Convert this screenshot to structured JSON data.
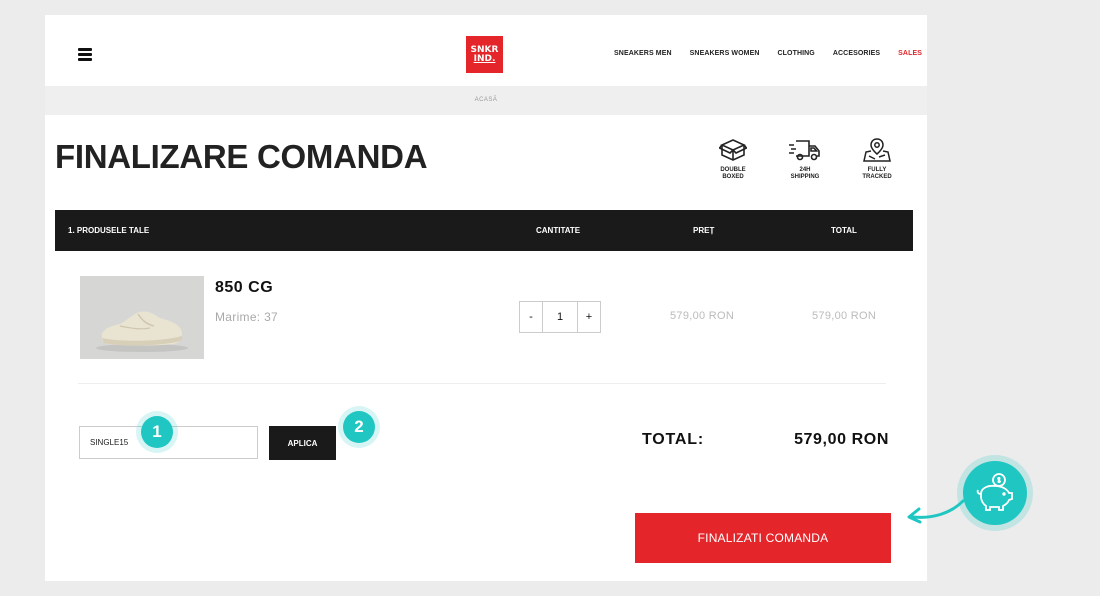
{
  "header": {
    "logo_line1": "SNKR",
    "logo_line2": "IND.",
    "nav": [
      "SNEAKERS MEN",
      "SNEAKERS WOMEN",
      "CLOTHING",
      "ACCESORIES",
      "SALES"
    ]
  },
  "breadcrumb": "ACASĂ",
  "page_title": "FINALIZARE COMANDA",
  "features": [
    {
      "icon": "box-icon",
      "line1": "DOUBLE",
      "line2": "BOXED"
    },
    {
      "icon": "truck-icon",
      "line1": "24H",
      "line2": "SHIPPING"
    },
    {
      "icon": "map-pin-icon",
      "line1": "FULLY",
      "line2": "TRACKED"
    }
  ],
  "table": {
    "headers": [
      "1. PRODUSELE TALE",
      "CANTITATE",
      "PREȚ",
      "TOTAL"
    ]
  },
  "product": {
    "name": "850 CG",
    "size": "Marime: 37",
    "quantity": "1",
    "qty_minus": "-",
    "qty_plus": "+",
    "price": "579,00 RON",
    "total": "579,00 RON"
  },
  "coupon": {
    "value": "SINGLE15",
    "apply_label": "APLICA"
  },
  "summary": {
    "total_label": "TOTAL:",
    "total_value": "579,00 RON"
  },
  "finalize_label": "FINALIZATI COMANDA",
  "annotations": {
    "marker1": "1",
    "marker2": "2"
  },
  "colors": {
    "brand_red": "#e4262b",
    "dark": "#1a1a1a",
    "annotation_teal": "#1fc6c2"
  }
}
